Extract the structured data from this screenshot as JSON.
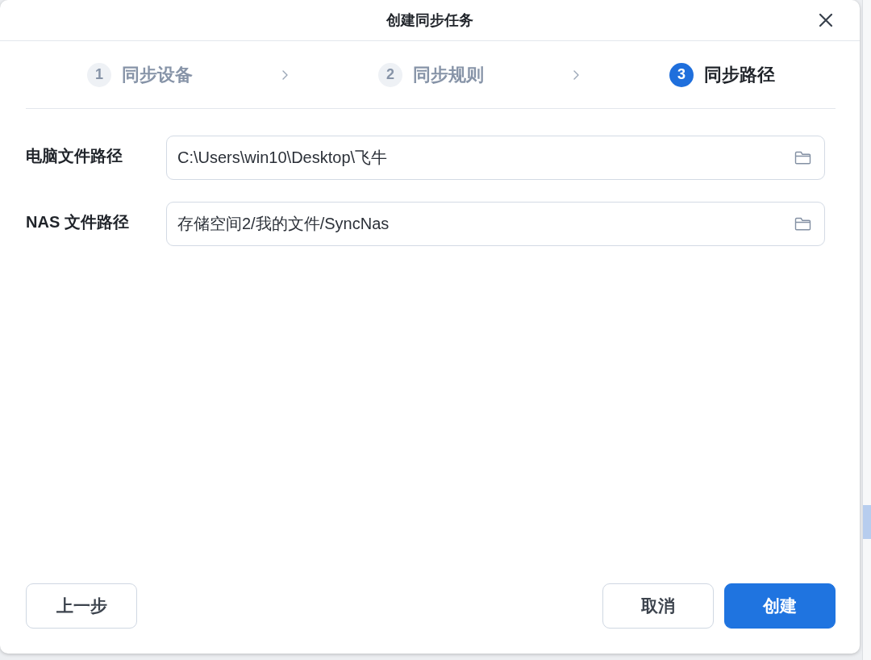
{
  "dialog": {
    "title": "创建同步任务"
  },
  "steps": [
    {
      "number": "1",
      "label": "同步设备",
      "selected": false
    },
    {
      "number": "2",
      "label": "同步规则",
      "selected": false
    },
    {
      "number": "3",
      "label": "同步路径",
      "selected": true
    }
  ],
  "fields": [
    {
      "label": "电脑文件路径",
      "value": "C:\\Users\\win10\\Desktop\\飞牛"
    },
    {
      "label": "NAS 文件路径",
      "value": "存储空间2/我的文件/SyncNas"
    }
  ],
  "footer_left": [
    {
      "label": "上一步",
      "kind": "secondary"
    }
  ],
  "footer_right": [
    {
      "label": "取消",
      "kind": "secondary"
    },
    {
      "label": "创建",
      "kind": "primary"
    }
  ]
}
